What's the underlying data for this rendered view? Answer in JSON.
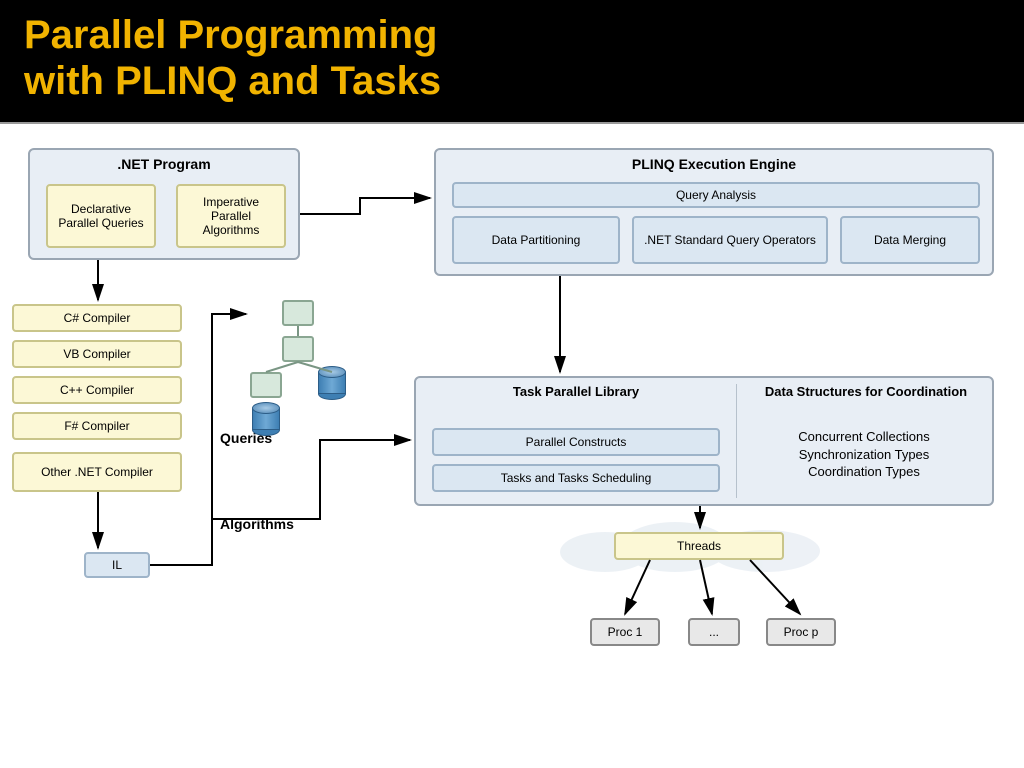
{
  "title_line1": "Parallel Programming",
  "title_line2": "with PLINQ and Tasks",
  "net_program": {
    "title": ".NET Program",
    "left": "Declarative Parallel Queries",
    "right": "Imperative Parallel Algorithms"
  },
  "compilers": [
    "C# Compiler",
    "VB Compiler",
    "C++ Compiler",
    "F# Compiler",
    "Other .NET Compiler"
  ],
  "il": "IL",
  "labels": {
    "queries": "Queries",
    "algorithms": "Algorithms"
  },
  "plinq": {
    "title": "PLINQ Execution Engine",
    "analysis": "Query Analysis",
    "part": "Data Partitioning",
    "stdops": ".NET Standard Query Operators",
    "merge": "Data Merging"
  },
  "tpl": {
    "title": "Task Parallel Library",
    "pc": "Parallel Constructs",
    "tts": "Tasks and Tasks Scheduling"
  },
  "ds": {
    "title": "Data Structures for Coordination",
    "l1": "Concurrent Collections",
    "l2": "Synchronization Types",
    "l3": "Coordination Types"
  },
  "threads": "Threads",
  "procs": [
    "Proc 1",
    "...",
    "Proc p"
  ]
}
